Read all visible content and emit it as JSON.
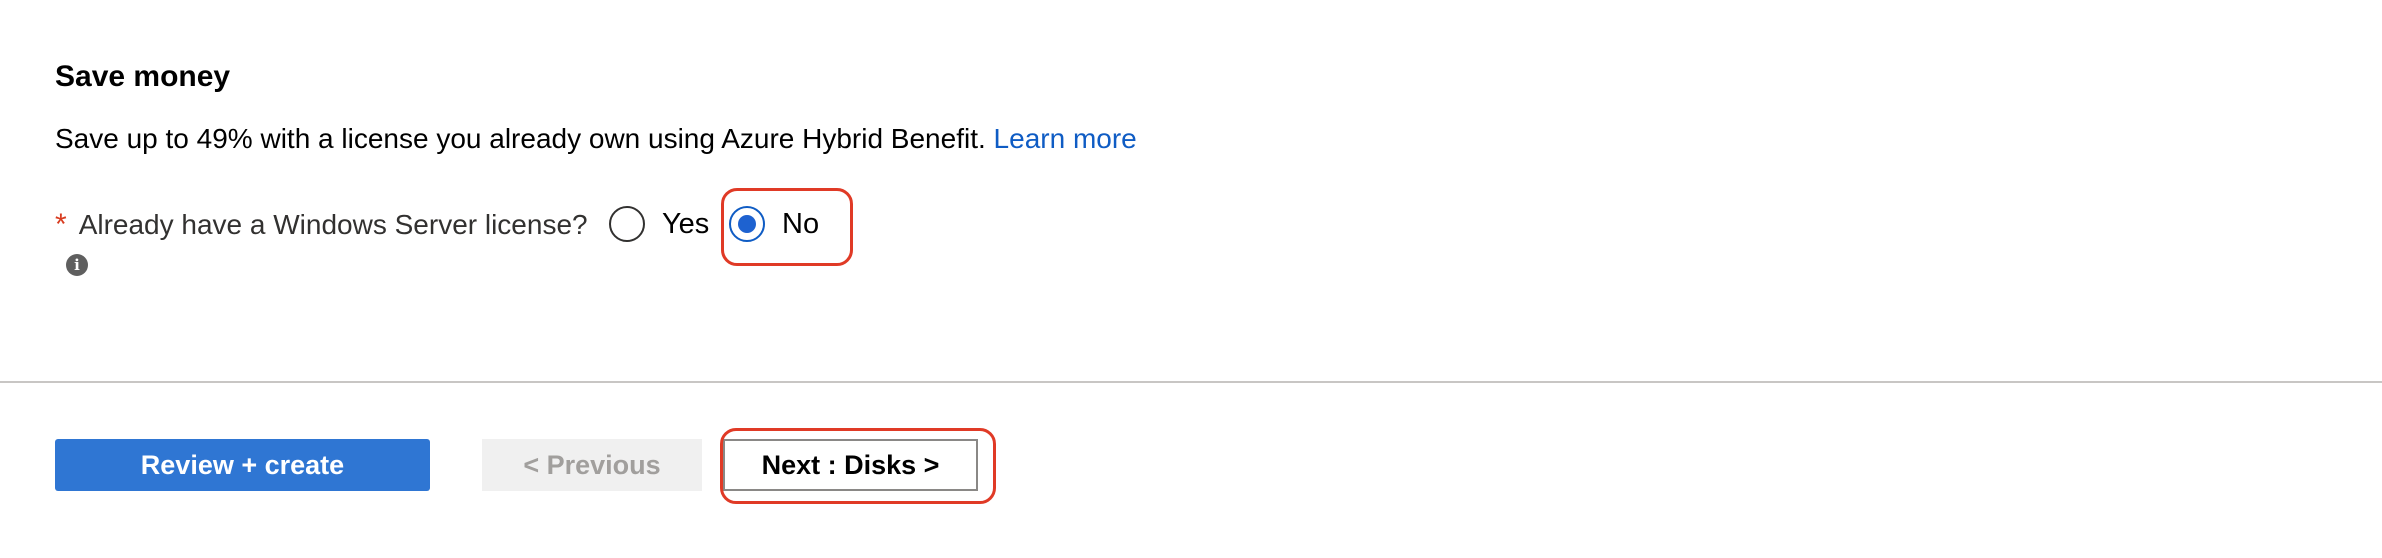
{
  "section": {
    "title": "Save money",
    "description": "Save up to 49% with a license you already own using Azure Hybrid Benefit.",
    "learn_more": "Learn more"
  },
  "license_field": {
    "required_marker": "*",
    "label": "Already have a Windows Server license?",
    "info_icon": "info-icon",
    "options": [
      {
        "label": "Yes",
        "selected": false
      },
      {
        "label": "No",
        "selected": true
      }
    ]
  },
  "footer": {
    "review_create_label": "Review + create",
    "previous_label": "< Previous",
    "next_label": "Next : Disks >"
  },
  "colors": {
    "accent": "#2f76d3",
    "link": "#0f5cc4",
    "required": "#d83b1f",
    "highlight": "#e03a26"
  }
}
